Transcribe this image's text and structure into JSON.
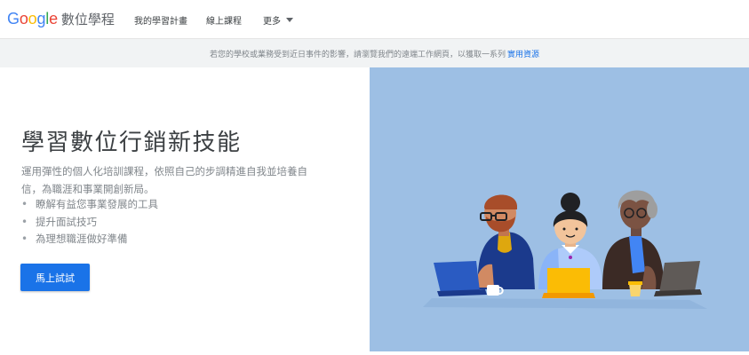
{
  "header": {
    "logo_letters": [
      {
        "char": "G",
        "color": "#4285f4"
      },
      {
        "char": "o",
        "color": "#ea4335"
      },
      {
        "char": "o",
        "color": "#fbbc05"
      },
      {
        "char": "g",
        "color": "#4285f4"
      },
      {
        "char": "l",
        "color": "#34a853"
      },
      {
        "char": "e",
        "color": "#ea4335"
      }
    ],
    "product_name": "數位學程",
    "nav": [
      "我的學習計畫",
      "線上課程",
      "更多"
    ]
  },
  "banner": {
    "text": "若您的學校或業務受到近日事件的影響，請瀏覽我們的遠端工作網頁，以獲取一系列",
    "link": "實用資源",
    "link_color": "#1a73e8"
  },
  "hero": {
    "title": "學習數位行銷新技能",
    "description": "運用彈性的個人化培訓課程，依照自己的步調精進自我並培養自信，為職涯和事業開創新局。",
    "bullets": [
      "瞭解有益您事業發展的工具",
      "提升面試技巧",
      "為理想職涯做好準備"
    ],
    "cta_label": "馬上試試",
    "cta_color": "#1a73e8",
    "illustration_bg": "#9dbfe4"
  }
}
